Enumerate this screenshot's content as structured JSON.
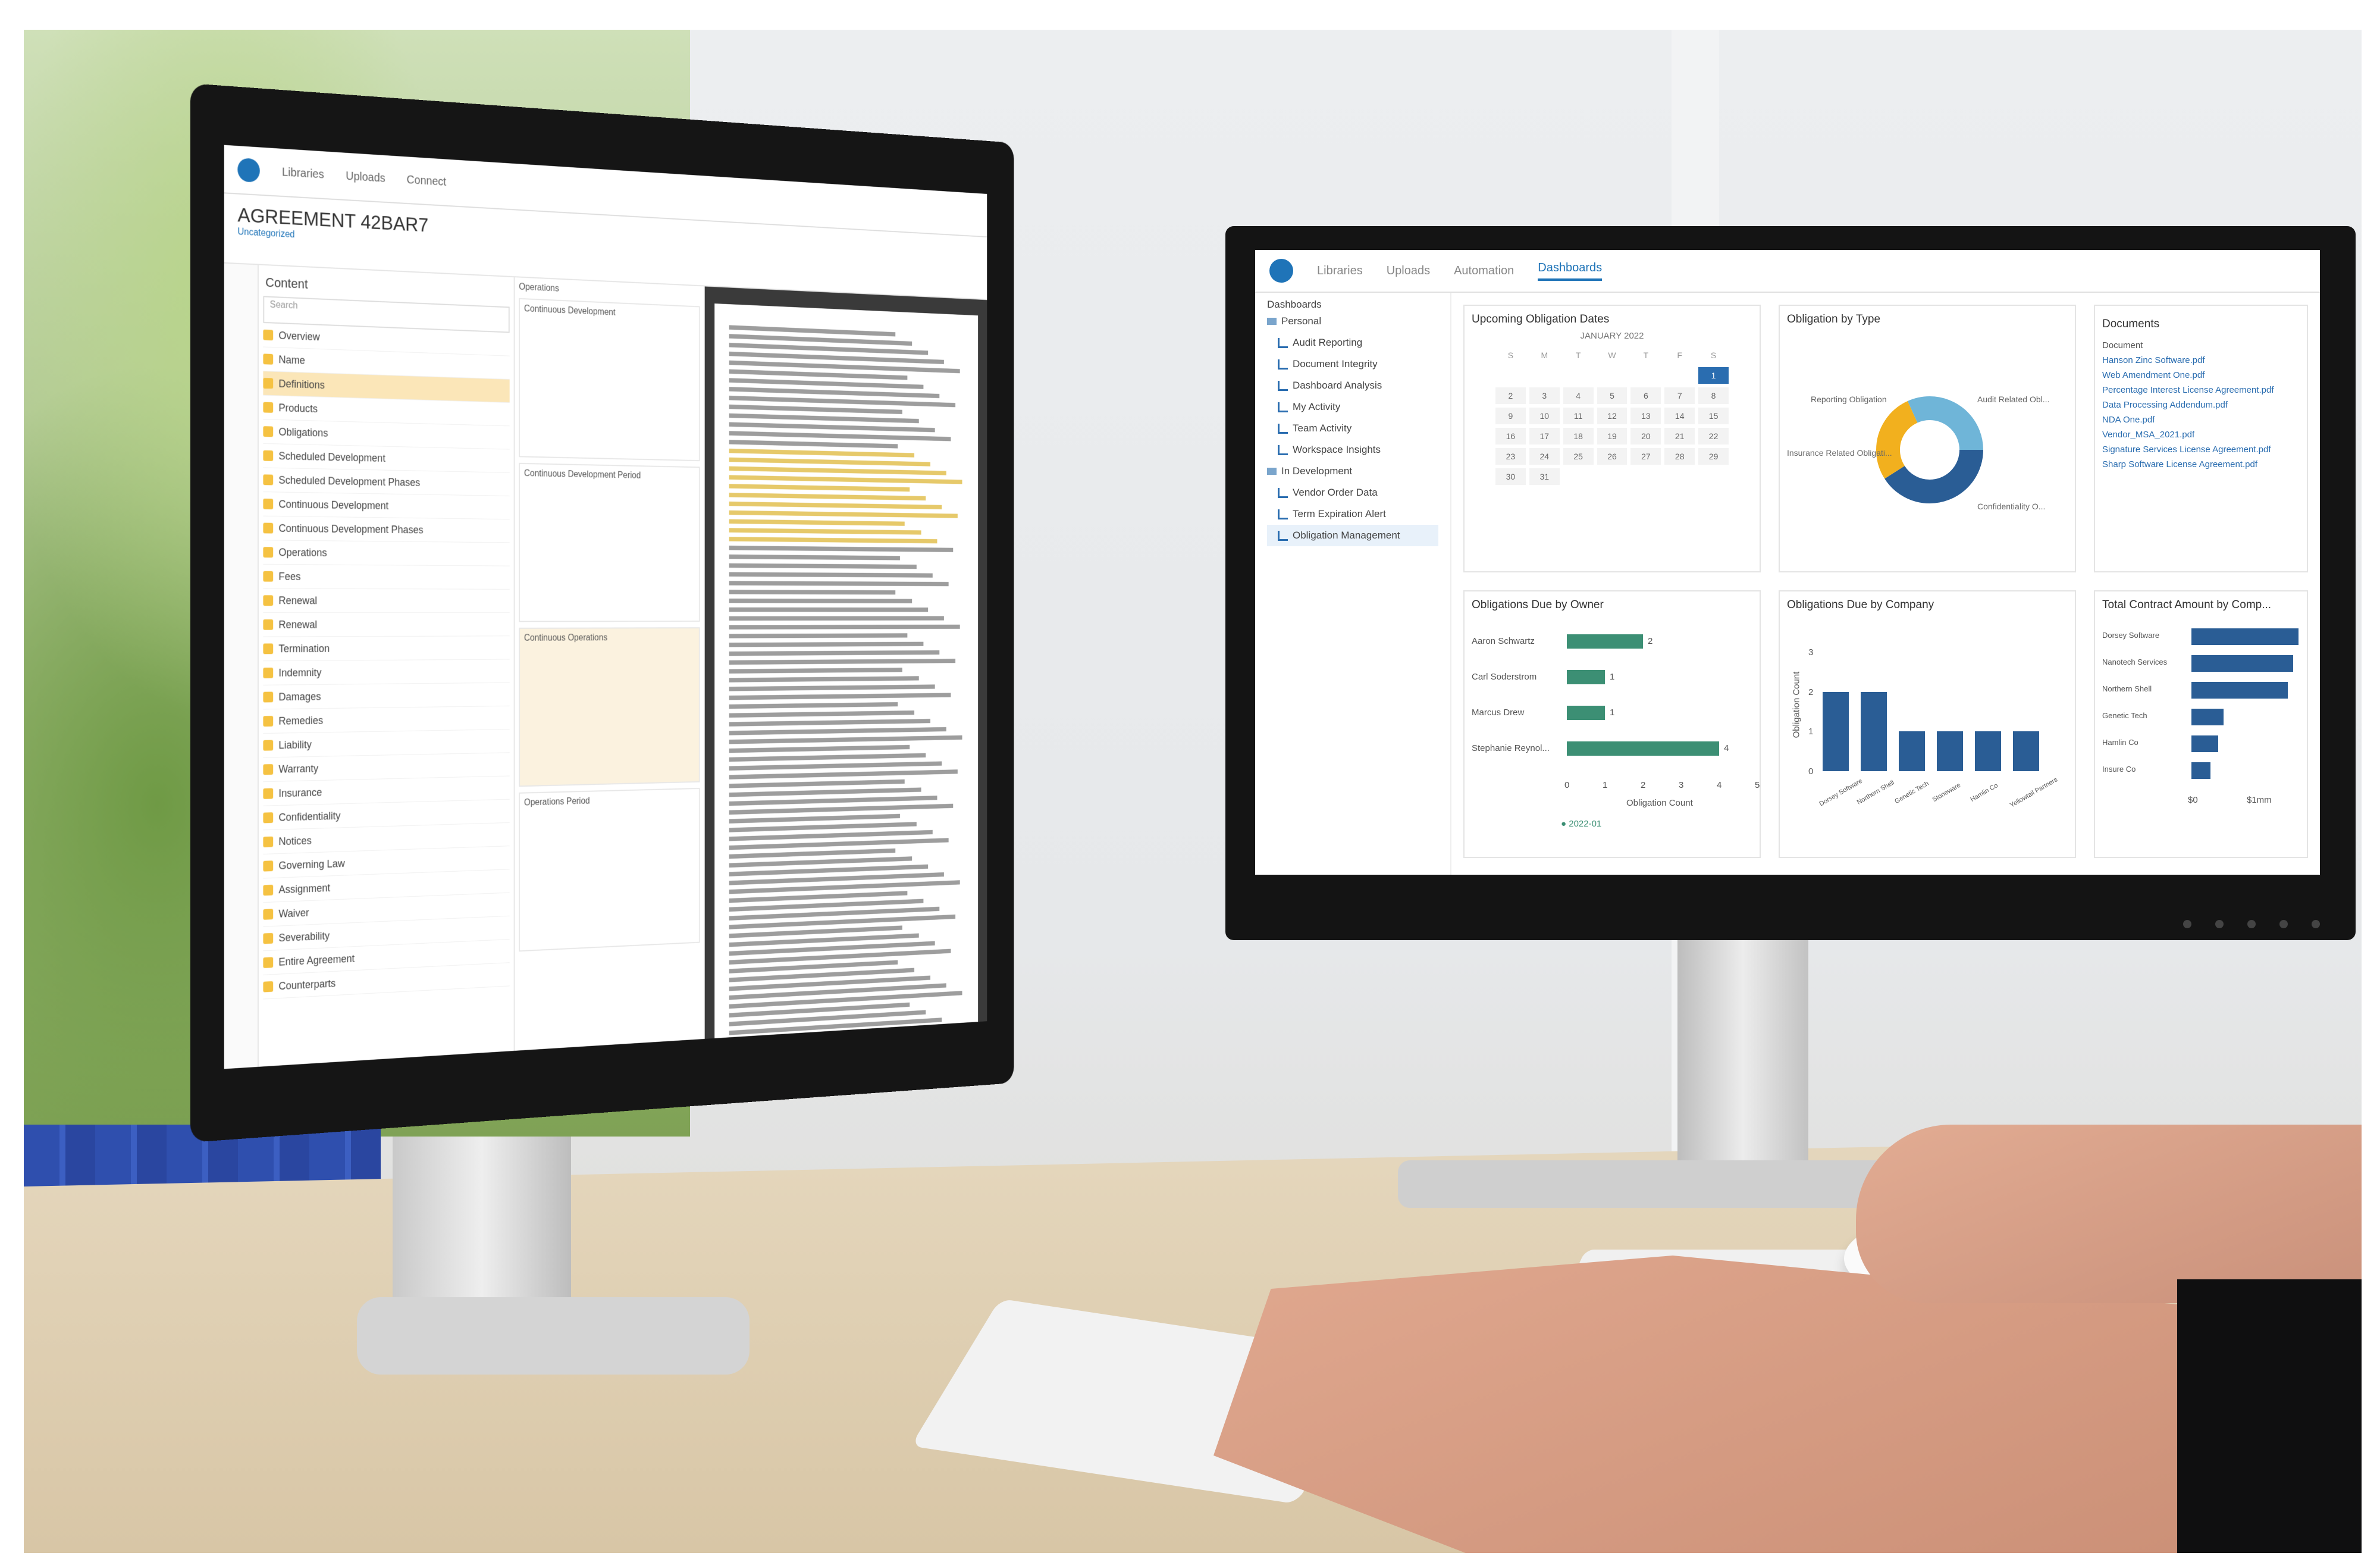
{
  "screen1": {
    "app_nav": [
      "Libraries",
      "Uploads",
      "Connect"
    ],
    "doc_title": "AGREEMENT 42BAR7",
    "doc_subtitle": "Uncategorized",
    "panel_title": "Content",
    "search_placeholder": "Search",
    "tree_items": [
      "Overview",
      "Name",
      "Definitions",
      "Products",
      "Obligations",
      "Scheduled Development",
      "Scheduled Development Phases",
      "Continuous Development",
      "Continuous Development Phases",
      "Operations",
      "Fees",
      "Renewal",
      "Renewal",
      "Termination",
      "Indemnity",
      "Damages",
      "Remedies",
      "Liability",
      "Warranty",
      "Insurance",
      "Confidentiality",
      "Notices",
      "Governing Law",
      "Assignment",
      "Waiver",
      "Severability",
      "Entire Agreement",
      "Counterparts"
    ],
    "mid_title": "Operations",
    "mid_sections": [
      "Continuous Development",
      "Continuous Development Period",
      "Continuous Operations",
      "Operations Period",
      "Operations Period"
    ]
  },
  "screen2": {
    "nav_tabs": [
      "Libraries",
      "Uploads",
      "Automation",
      "Dashboards"
    ],
    "active_tab": "Dashboards",
    "side_title": "Dashboards",
    "side_items": [
      {
        "label": "Personal",
        "type": "folder"
      },
      {
        "label": "Audit Reporting",
        "type": "chart"
      },
      {
        "label": "Document Integrity",
        "type": "chart"
      },
      {
        "label": "Dashboard Analysis",
        "type": "chart"
      },
      {
        "label": "My Activity",
        "type": "chart"
      },
      {
        "label": "Team Activity",
        "type": "chart"
      },
      {
        "label": "Workspace Insights",
        "type": "chart"
      },
      {
        "label": "In Development",
        "type": "folder"
      },
      {
        "label": "Vendor Order Data",
        "type": "chart"
      },
      {
        "label": "Term Expiration Alert",
        "type": "chart"
      },
      {
        "label": "Obligation Management",
        "type": "chart"
      }
    ],
    "cards": {
      "calendar": {
        "title": "Upcoming Obligation Dates",
        "month": "JANUARY 2022",
        "weekdays": [
          "S",
          "M",
          "T",
          "W",
          "T",
          "F",
          "S"
        ],
        "days": [
          "",
          "",
          "",
          "",
          "",
          "",
          "1",
          "2",
          "3",
          "4",
          "5",
          "6",
          "7",
          "8",
          "9",
          "10",
          "11",
          "12",
          "13",
          "14",
          "15",
          "16",
          "17",
          "18",
          "19",
          "20",
          "21",
          "22",
          "23",
          "24",
          "25",
          "26",
          "27",
          "28",
          "29",
          "30",
          "31",
          "",
          "",
          "",
          "",
          ""
        ],
        "today": "1"
      },
      "donut": {
        "title": "Obligation by Type",
        "labels": [
          "Reporting Obligation",
          "Audit Related Obl...",
          "Insurance Related Obligati...",
          "Confidentiality O..."
        ]
      },
      "documents": {
        "title": "Documents",
        "items": [
          "Document",
          "Hanson Zinc Software.pdf",
          "Web Amendment One.pdf",
          "Percentage Interest License Agreement.pdf",
          "Data Processing Addendum.pdf",
          "NDA One.pdf",
          "Vendor_MSA_2021.pdf",
          "Signature Services License Agreement.pdf",
          "Sharp Software License Agreement.pdf"
        ]
      },
      "by_owner": {
        "title": "Obligations Due by Owner",
        "owners": [
          "Aaron Schwartz",
          "Carl Soderstrom",
          "Marcus Drew",
          "Stephanie Reynol..."
        ],
        "values": [
          2,
          1,
          1,
          4
        ],
        "xaxis": "Obligation Count",
        "ticks": [
          "0",
          "1",
          "2",
          "3",
          "4",
          "5"
        ],
        "legend": "2022-01"
      },
      "by_company": {
        "title": "Obligations Due by Company",
        "companies": [
          "Dorsey Software",
          "Northern Shell",
          "Genetic Tech",
          "Stoneware",
          "Hamlin Co",
          "Yellowtail Partners"
        ],
        "values": [
          2,
          2,
          1,
          1,
          1,
          1
        ],
        "yaxis": "Obligation Count",
        "yticks": [
          "0",
          "1",
          "2",
          "3"
        ]
      },
      "total_contract": {
        "title": "Total Contract Amount by Comp...",
        "companies": [
          "Dorsey Software",
          "Nanotech Services",
          "Northern Shell",
          "Genetic Tech",
          "Hamlin Co",
          "Insure Co"
        ],
        "values": [
          100,
          95,
          90,
          30,
          25,
          18
        ],
        "ticks": [
          "$0",
          "$1mm"
        ]
      }
    }
  }
}
